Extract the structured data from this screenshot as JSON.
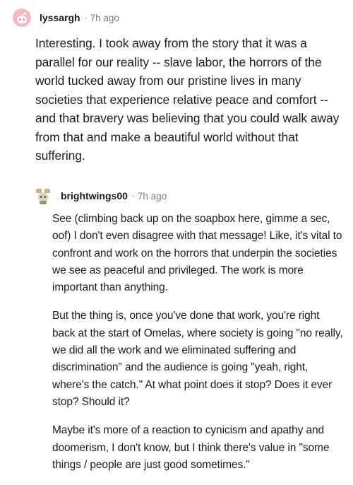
{
  "comments": [
    {
      "username": "lyssargh",
      "separator": "·",
      "time": "7h ago",
      "avatar_icon": "pink-snoo-avatar",
      "body": "Interesting. I took away from the story that it was a parallel for our reality -- slave labor, the horrors of the world tucked away from our pristine lives in many societies that experience relative peace and comfort -- and that bravery was believing that you could walk away from that and make a beautiful world without that suffering."
    },
    {
      "username": "brightwings00",
      "separator": "·",
      "time": "7h ago",
      "avatar_icon": "custom-snoo-avatar",
      "paragraphs": [
        "See (climbing back up on the soapbox here, gimme a sec, oof) I don't even disagree with that message! Like, it's vital to confront and work on the horrors that underpin the societies we see as peaceful and privileged. The work is more important than anything.",
        "But the thing is, once you've done that work, you're right back at the start of Omelas, where society is going \"no really, we did all the work and we eliminated suffering and discrimination\" and the audience is going \"yeah, right, where's the catch.\" At what point does it stop? Does it ever stop? Should it?",
        "Maybe it's more of a reaction to cynicism and apathy and doomerism, I don't know, but I think there's value in \"some things / people are just good sometimes.\""
      ]
    }
  ],
  "colors": {
    "text": "#1c1c1c",
    "meta": "#7c7c7c",
    "avatar1_bg": "#f5b8c4"
  }
}
